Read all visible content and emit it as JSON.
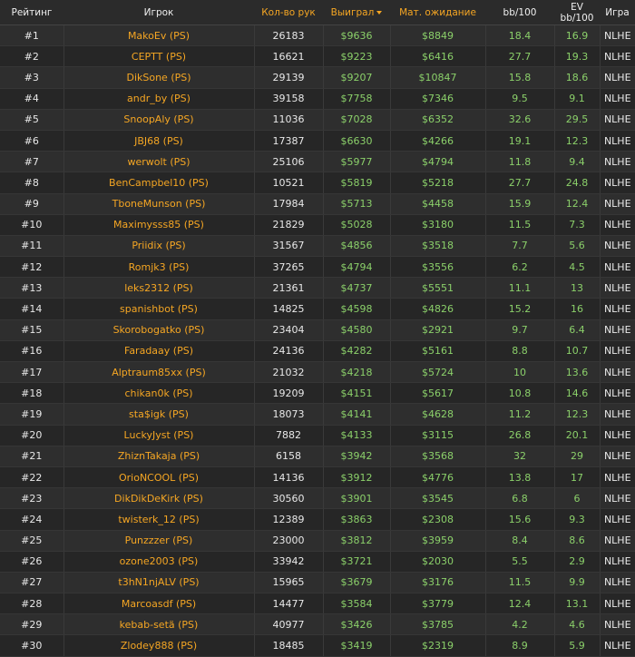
{
  "headers": {
    "rank": "Рейтинг",
    "player": "Игрок",
    "hands": "Кол-во рук",
    "won": "Выиграл",
    "ev": "Мат. ожидание",
    "bb100": "bb/100",
    "evbb100": "EV bb/100",
    "game": "Игра"
  },
  "colors": {
    "accent": "#f5a623",
    "money": "#8bd06a",
    "background": "#2b2b2b"
  },
  "sort": {
    "column": "won",
    "direction": "desc",
    "icon": "caret-down-icon"
  },
  "rows": [
    {
      "rank": "#1",
      "player": "MakoEv (PS)",
      "hands": "26183",
      "won": "$9636",
      "ev": "$8849",
      "bb100": "18.4",
      "evbb100": "16.9",
      "game": "NLHE"
    },
    {
      "rank": "#2",
      "player": "CEPTT (PS)",
      "hands": "16621",
      "won": "$9223",
      "ev": "$6416",
      "bb100": "27.7",
      "evbb100": "19.3",
      "game": "NLHE"
    },
    {
      "rank": "#3",
      "player": "DikSone (PS)",
      "hands": "29139",
      "won": "$9207",
      "ev": "$10847",
      "bb100": "15.8",
      "evbb100": "18.6",
      "game": "NLHE"
    },
    {
      "rank": "#4",
      "player": "andr_by (PS)",
      "hands": "39158",
      "won": "$7758",
      "ev": "$7346",
      "bb100": "9.5",
      "evbb100": "9.1",
      "game": "NLHE"
    },
    {
      "rank": "#5",
      "player": "SnoopAly (PS)",
      "hands": "11036",
      "won": "$7028",
      "ev": "$6352",
      "bb100": "32.6",
      "evbb100": "29.5",
      "game": "NLHE"
    },
    {
      "rank": "#6",
      "player": "JBJ68 (PS)",
      "hands": "17387",
      "won": "$6630",
      "ev": "$4266",
      "bb100": "19.1",
      "evbb100": "12.3",
      "game": "NLHE"
    },
    {
      "rank": "#7",
      "player": "werwolt (PS)",
      "hands": "25106",
      "won": "$5977",
      "ev": "$4794",
      "bb100": "11.8",
      "evbb100": "9.4",
      "game": "NLHE"
    },
    {
      "rank": "#8",
      "player": "BenCampbel10 (PS)",
      "hands": "10521",
      "won": "$5819",
      "ev": "$5218",
      "bb100": "27.7",
      "evbb100": "24.8",
      "game": "NLHE"
    },
    {
      "rank": "#9",
      "player": "TboneMunson (PS)",
      "hands": "17984",
      "won": "$5713",
      "ev": "$4458",
      "bb100": "15.9",
      "evbb100": "12.4",
      "game": "NLHE"
    },
    {
      "rank": "#10",
      "player": "Maximysss85 (PS)",
      "hands": "21829",
      "won": "$5028",
      "ev": "$3180",
      "bb100": "11.5",
      "evbb100": "7.3",
      "game": "NLHE"
    },
    {
      "rank": "#11",
      "player": "Priidix (PS)",
      "hands": "31567",
      "won": "$4856",
      "ev": "$3518",
      "bb100": "7.7",
      "evbb100": "5.6",
      "game": "NLHE"
    },
    {
      "rank": "#12",
      "player": "Romjk3 (PS)",
      "hands": "37265",
      "won": "$4794",
      "ev": "$3556",
      "bb100": "6.2",
      "evbb100": "4.5",
      "game": "NLHE"
    },
    {
      "rank": "#13",
      "player": "leks2312 (PS)",
      "hands": "21361",
      "won": "$4737",
      "ev": "$5551",
      "bb100": "11.1",
      "evbb100": "13",
      "game": "NLHE"
    },
    {
      "rank": "#14",
      "player": "spanishbot (PS)",
      "hands": "14825",
      "won": "$4598",
      "ev": "$4826",
      "bb100": "15.2",
      "evbb100": "16",
      "game": "NLHE"
    },
    {
      "rank": "#15",
      "player": "Skorobogatko (PS)",
      "hands": "23404",
      "won": "$4580",
      "ev": "$2921",
      "bb100": "9.7",
      "evbb100": "6.4",
      "game": "NLHE"
    },
    {
      "rank": "#16",
      "player": "Faradaay (PS)",
      "hands": "24136",
      "won": "$4282",
      "ev": "$5161",
      "bb100": "8.8",
      "evbb100": "10.7",
      "game": "NLHE"
    },
    {
      "rank": "#17",
      "player": "Alptraum85xx (PS)",
      "hands": "21032",
      "won": "$4218",
      "ev": "$5724",
      "bb100": "10",
      "evbb100": "13.6",
      "game": "NLHE"
    },
    {
      "rank": "#18",
      "player": "chikan0k (PS)",
      "hands": "19209",
      "won": "$4151",
      "ev": "$5617",
      "bb100": "10.8",
      "evbb100": "14.6",
      "game": "NLHE"
    },
    {
      "rank": "#19",
      "player": "sta$igk (PS)",
      "hands": "18073",
      "won": "$4141",
      "ev": "$4628",
      "bb100": "11.2",
      "evbb100": "12.3",
      "game": "NLHE"
    },
    {
      "rank": "#20",
      "player": "LuckyJyst (PS)",
      "hands": "7882",
      "won": "$4133",
      "ev": "$3115",
      "bb100": "26.8",
      "evbb100": "20.1",
      "game": "NLHE"
    },
    {
      "rank": "#21",
      "player": "ZhiznTakaja (PS)",
      "hands": "6158",
      "won": "$3942",
      "ev": "$3568",
      "bb100": "32",
      "evbb100": "29",
      "game": "NLHE"
    },
    {
      "rank": "#22",
      "player": "OrioNCOOL (PS)",
      "hands": "14136",
      "won": "$3912",
      "ev": "$4776",
      "bb100": "13.8",
      "evbb100": "17",
      "game": "NLHE"
    },
    {
      "rank": "#23",
      "player": "DikDikDeKirk (PS)",
      "hands": "30560",
      "won": "$3901",
      "ev": "$3545",
      "bb100": "6.8",
      "evbb100": "6",
      "game": "NLHE"
    },
    {
      "rank": "#24",
      "player": "twisterk_12 (PS)",
      "hands": "12389",
      "won": "$3863",
      "ev": "$2308",
      "bb100": "15.6",
      "evbb100": "9.3",
      "game": "NLHE"
    },
    {
      "rank": "#25",
      "player": "Punzzzer (PS)",
      "hands": "23000",
      "won": "$3812",
      "ev": "$3959",
      "bb100": "8.4",
      "evbb100": "8.6",
      "game": "NLHE"
    },
    {
      "rank": "#26",
      "player": "ozone2003 (PS)",
      "hands": "33942",
      "won": "$3721",
      "ev": "$2030",
      "bb100": "5.5",
      "evbb100": "2.9",
      "game": "NLHE"
    },
    {
      "rank": "#27",
      "player": "t3hN1njALV (PS)",
      "hands": "15965",
      "won": "$3679",
      "ev": "$3176",
      "bb100": "11.5",
      "evbb100": "9.9",
      "game": "NLHE"
    },
    {
      "rank": "#28",
      "player": "Marcoasdf (PS)",
      "hands": "14477",
      "won": "$3584",
      "ev": "$3779",
      "bb100": "12.4",
      "evbb100": "13.1",
      "game": "NLHE"
    },
    {
      "rank": "#29",
      "player": "kebab-setä (PS)",
      "hands": "40977",
      "won": "$3426",
      "ev": "$3785",
      "bb100": "4.2",
      "evbb100": "4.6",
      "game": "NLHE"
    },
    {
      "rank": "#30",
      "player": "Zlodey888 (PS)",
      "hands": "18485",
      "won": "$3419",
      "ev": "$2319",
      "bb100": "8.9",
      "evbb100": "5.9",
      "game": "NLHE"
    }
  ]
}
